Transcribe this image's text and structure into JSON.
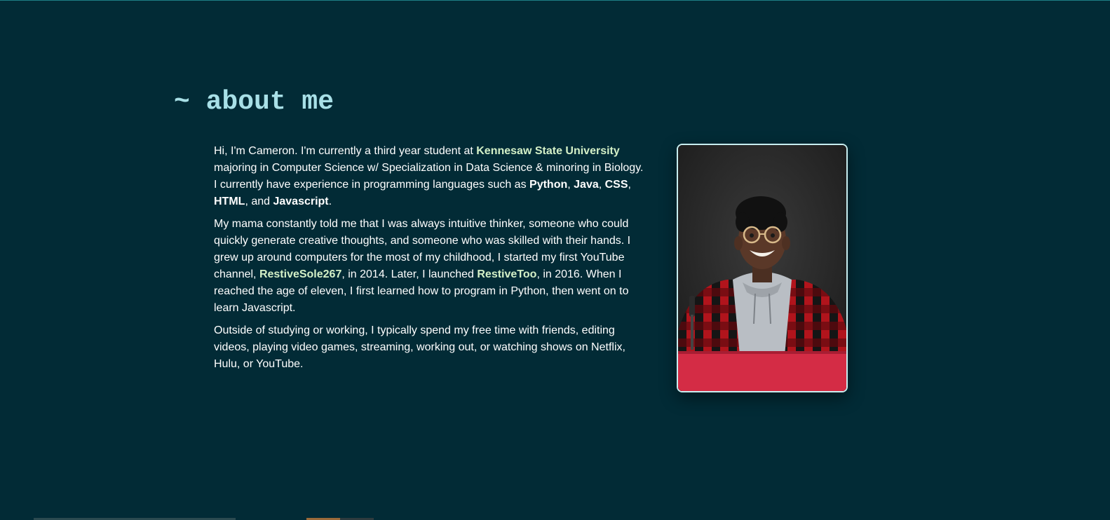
{
  "heading": "~ about me",
  "bio": {
    "p1": {
      "t1": "Hi, I'm Cameron. I'm currently a third year student at ",
      "university": "Kennesaw State University",
      "t2": " majoring in Computer Science w/ Specialization in Data Science & minoring in Biology. I currently have experience in programming languages such as ",
      "lang1": "Python",
      "sep1": ", ",
      "lang2": "Java",
      "sep2": ", ",
      "lang3": "CSS",
      "sep3": ", ",
      "lang4": "HTML",
      "sep4": ", and ",
      "lang5": "Javascript",
      "end": "."
    },
    "p2": {
      "t1": "My mama constantly told me that I was always intuitive thinker, someone who could quickly generate creative thoughts, and someone who was skilled with their hands. I grew up around computers for the most of my childhood, I started my first YouTube channel, ",
      "channel1": "RestiveSole267",
      "t2": ", in 2014. Later, I launched ",
      "channel2": "RestiveToo",
      "t3": ", in 2016. When I reached the age of eleven, I first learned how to program in Python, then went on to learn Javascript."
    },
    "p3": "Outside of studying or working, I typically spend my free time with friends, editing videos, playing video games, streaming, working out, or watching shows on Netflix, Hulu, or YouTube."
  },
  "colors": {
    "background": "#022b36",
    "heading": "#a8e0e7",
    "link_highlight": "#d4f0c7",
    "photo_border": "#c8eef0"
  },
  "icons": {
    "photo": "profile-portrait"
  }
}
